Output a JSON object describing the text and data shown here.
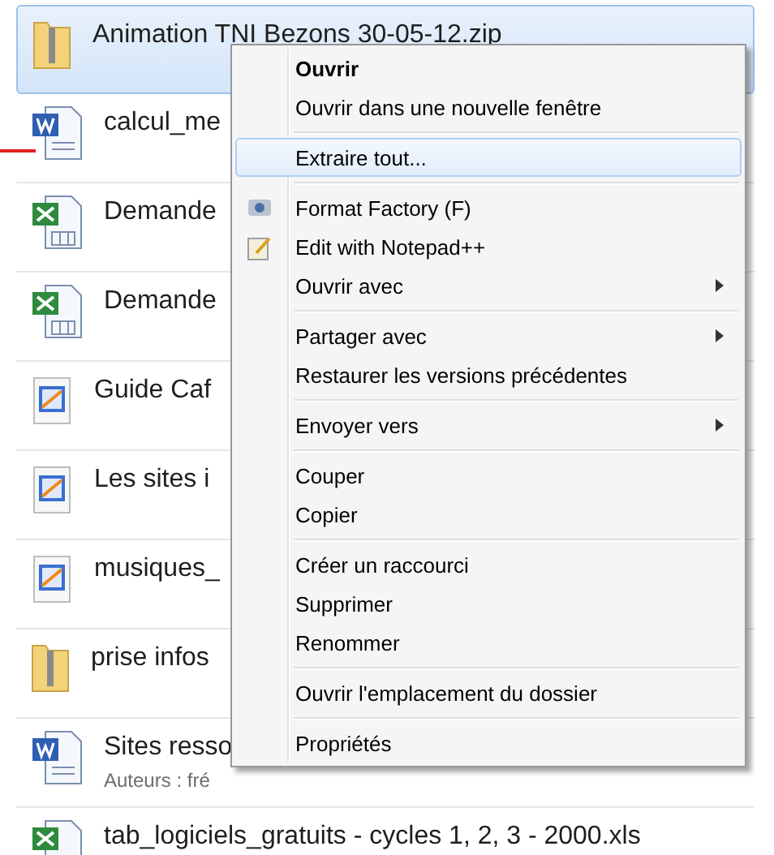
{
  "files": [
    {
      "kind": "zip",
      "name": "Animation TNI Bezons 30-05-12.zip",
      "selected": true
    },
    {
      "kind": "word",
      "name": "calcul_me",
      "selected": false
    },
    {
      "kind": "excel",
      "name": "Demande",
      "selected": false
    },
    {
      "kind": "excel",
      "name": "Demande",
      "selected": false
    },
    {
      "kind": "chart",
      "name": "Guide Caf",
      "selected": false
    },
    {
      "kind": "chart",
      "name": "Les sites i",
      "selected": false
    },
    {
      "kind": "chart",
      "name": "musiques_",
      "selected": false
    },
    {
      "kind": "zip",
      "name": "prise infos",
      "selected": false
    },
    {
      "kind": "word",
      "name": "Sites resso",
      "authors": "Auteurs : fré",
      "selected": false
    },
    {
      "kind": "excel",
      "name": "tab_logiciels_gratuits - cycles 1, 2, 3 - 2000.xls",
      "selected": false
    }
  ],
  "context_menu": {
    "groups": [
      [
        {
          "label": "Ouvrir",
          "bold": true,
          "selected": false
        },
        {
          "label": "Ouvrir dans une nouvelle fenêtre",
          "bold": false,
          "selected": false
        }
      ],
      [
        {
          "label": "Extraire tout...",
          "bold": false,
          "selected": true
        }
      ],
      [
        {
          "label": "Format Factory (F)",
          "kind": "converter",
          "bold": false,
          "selected": false
        },
        {
          "label": "Edit with Notepad++",
          "kind": "editor",
          "bold": false,
          "selected": false
        },
        {
          "label": "Ouvrir avec",
          "submenu": true,
          "bold": false,
          "selected": false
        }
      ],
      [
        {
          "label": "Partager avec",
          "submenu": true,
          "bold": false,
          "selected": false
        },
        {
          "label": "Restaurer les versions précédentes",
          "bold": false,
          "selected": false
        }
      ],
      [
        {
          "label": "Envoyer vers",
          "submenu": true,
          "bold": false,
          "selected": false
        }
      ],
      [
        {
          "label": "Couper",
          "bold": false,
          "selected": false
        },
        {
          "label": "Copier",
          "bold": false,
          "selected": false
        }
      ],
      [
        {
          "label": "Créer un raccourci",
          "bold": false,
          "selected": false
        },
        {
          "label": "Supprimer",
          "bold": false,
          "selected": false
        },
        {
          "label": "Renommer",
          "bold": false,
          "selected": false
        }
      ],
      [
        {
          "label": "Ouvrir l'emplacement du dossier",
          "bold": false,
          "selected": false
        }
      ],
      [
        {
          "label": "Propriétés",
          "bold": false,
          "selected": false
        }
      ]
    ]
  }
}
